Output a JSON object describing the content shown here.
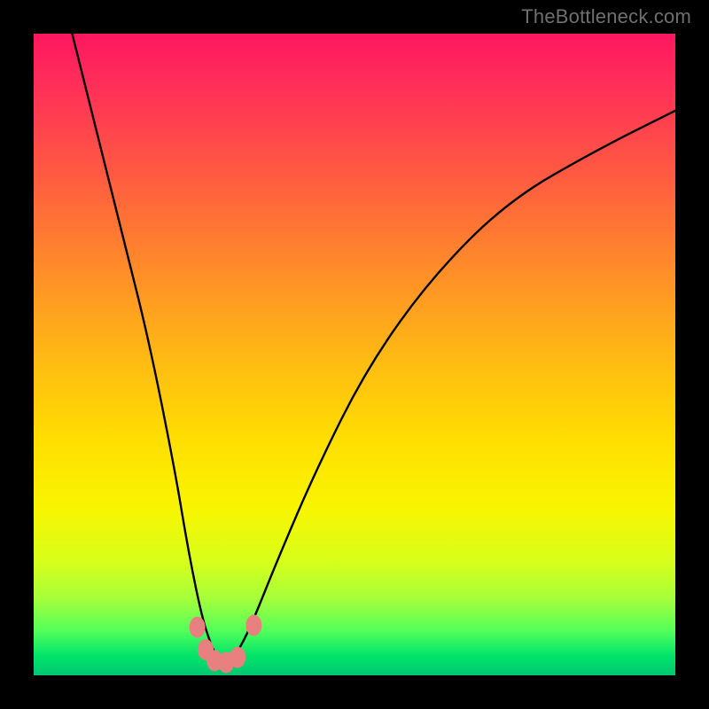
{
  "watermark": "TheBottleneck.com",
  "chart_data": {
    "type": "line",
    "title": "",
    "xlabel": "",
    "ylabel": "",
    "xlim": [
      0,
      100
    ],
    "ylim": [
      0,
      100
    ],
    "note": "Axes have no visible tick labels; values below are read-offs from curve geometry relative to the colored plot area (0,0 = bottom-left, 100,100 = top-right of that area).",
    "series": [
      {
        "name": "bottleneck-curve",
        "x": [
          6,
          10,
          14,
          18,
          22,
          24,
          26,
          27.5,
          29,
          30.5,
          32,
          34,
          38,
          44,
          52,
          62,
          74,
          88,
          100
        ],
        "y": [
          100,
          84,
          68,
          52,
          32,
          20,
          10,
          5,
          2,
          2,
          4,
          8,
          18,
          32,
          48,
          62,
          74,
          82,
          88
        ]
      }
    ],
    "markers": [
      {
        "name": "bump-left-upper",
        "x": 25.5,
        "y": 7.5
      },
      {
        "name": "bump-left-mid",
        "x": 26.8,
        "y": 4.0
      },
      {
        "name": "bump-bottom-1",
        "x": 28.2,
        "y": 2.3
      },
      {
        "name": "bump-bottom-2",
        "x": 30.0,
        "y": 2.0
      },
      {
        "name": "bump-bottom-3",
        "x": 31.8,
        "y": 2.8
      },
      {
        "name": "bump-right",
        "x": 34.3,
        "y": 7.8
      }
    ],
    "gradient_stops_top_to_bottom": [
      {
        "pos": 0.0,
        "color": "#ff1660"
      },
      {
        "pos": 0.22,
        "color": "#ff5a41"
      },
      {
        "pos": 0.5,
        "color": "#ffb814"
      },
      {
        "pos": 0.74,
        "color": "#f8f500"
      },
      {
        "pos": 0.93,
        "color": "#54ff5a"
      },
      {
        "pos": 1.0,
        "color": "#00c772"
      }
    ]
  }
}
